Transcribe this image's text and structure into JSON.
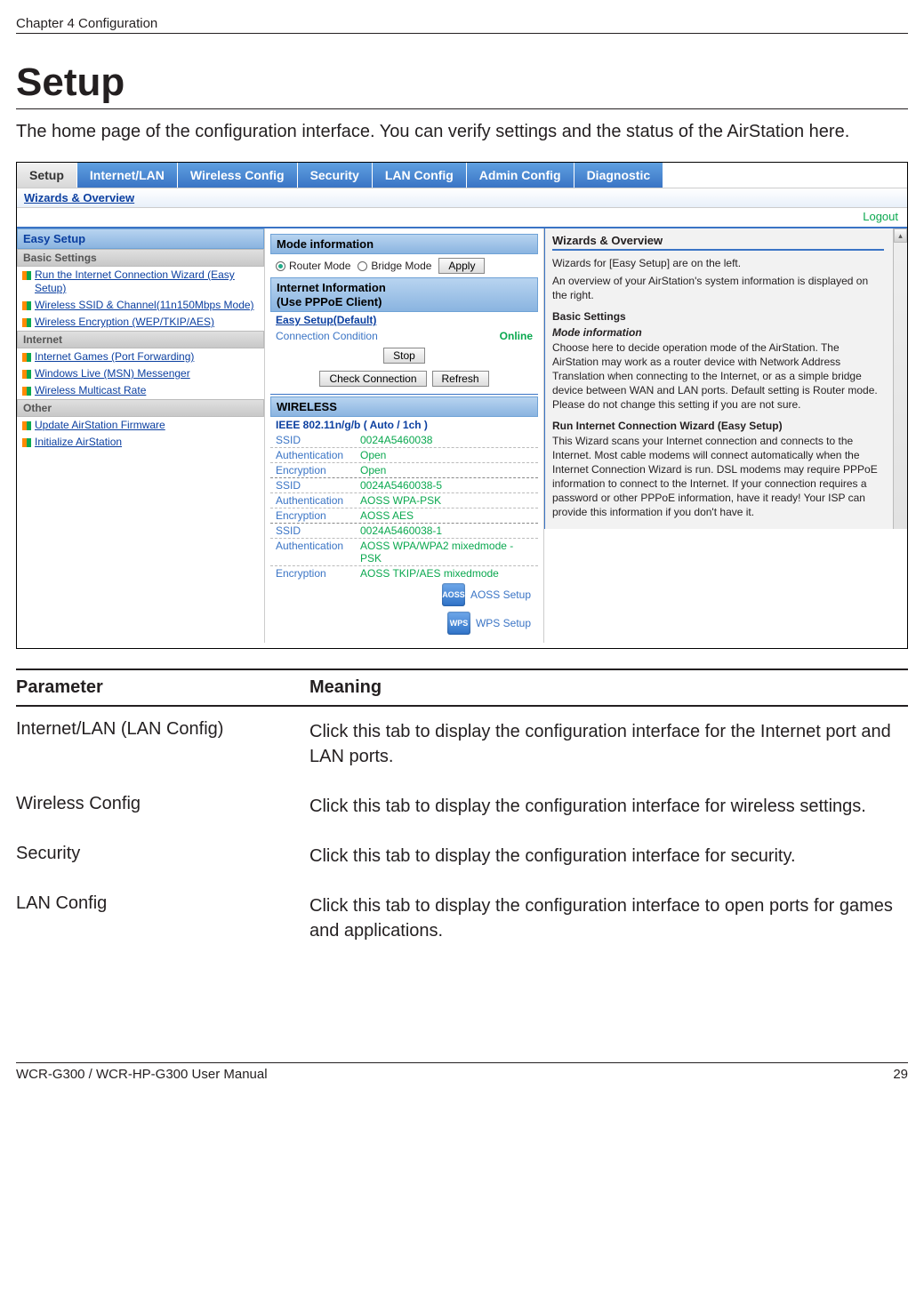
{
  "doc": {
    "header_left": "Chapter 4  Configuration",
    "title": "Setup",
    "intro": "The home page of the configuration interface. You can verify settings and the status of the AirStation here.",
    "footer_left": "WCR-G300 / WCR-HP-G300 User Manual",
    "footer_right": "29"
  },
  "tabs": {
    "setup": "Setup",
    "internet_lan": "Internet/LAN",
    "wireless": "Wireless Config",
    "security": "Security",
    "lan": "LAN Config",
    "admin": "Admin Config",
    "diag": "Diagnostic"
  },
  "subnav": {
    "link": "Wizards & Overview"
  },
  "logout": "Logout",
  "left": {
    "head": "Easy Setup",
    "sub_basic": "Basic Settings",
    "links_basic": [
      "Run the Internet Connection Wizard (Easy Setup)",
      "Wireless SSID & Channel(11n150Mbps Mode)",
      "Wireless Encryption (WEP/TKIP/AES)"
    ],
    "sub_internet": "Internet",
    "links_internet": [
      "Internet Games (Port Forwarding)",
      "Windows Live (MSN) Messenger",
      "Wireless Multicast Rate"
    ],
    "sub_other": "Other",
    "links_other": [
      "Update AirStation Firmware",
      "Initialize AirStation"
    ]
  },
  "mid": {
    "mode_head": "Mode information",
    "mode_router": "Router Mode",
    "mode_bridge": "Bridge Mode",
    "apply": "Apply",
    "inet_head1": "Internet Information",
    "inet_head2": "(Use PPPoE Client)",
    "easy_default": "Easy Setup(Default)",
    "conn_cond_label": "Connection Condition",
    "conn_cond_value": "Online",
    "stop": "Stop",
    "check_conn": "Check Connection",
    "refresh": "Refresh",
    "wireless_head": "WIRELESS",
    "ieee": "IEEE 802.11n/g/b ( Auto / 1ch )",
    "rows": [
      {
        "k": "SSID",
        "v": "0024A5460038"
      },
      {
        "k": "Authentication",
        "v": "Open"
      },
      {
        "k": "Encryption",
        "v": "Open"
      },
      {
        "k": "SSID",
        "v": "0024A5460038-5"
      },
      {
        "k": "Authentication",
        "v": "AOSS WPA-PSK"
      },
      {
        "k": "Encryption",
        "v": "AOSS AES"
      },
      {
        "k": "SSID",
        "v": "0024A5460038-1"
      },
      {
        "k": "Authentication",
        "v": "AOSS WPA/WPA2 mixedmode - PSK"
      },
      {
        "k": "Encryption",
        "v": "AOSS TKIP/AES mixedmode"
      }
    ],
    "aoss_setup": "AOSS Setup",
    "wps_setup": "WPS Setup"
  },
  "right": {
    "title": "Wizards & Overview",
    "p1": "Wizards for [Easy Setup] are on the left.",
    "p2": "An overview of your AirStation's system information is displayed on the right.",
    "h_basic": "Basic Settings",
    "h_mode": "Mode information",
    "p_mode": "Choose here to decide operation mode of the AirStation. The AirStation may work as a router device with Network Address Translation when connecting to the Internet, or as a simple bridge device between WAN and LAN ports. Default setting is Router mode. Please do not change this setting if you are not sure.",
    "h_wizard": "Run Internet Connection Wizard (Easy Setup)",
    "p_wizard": "This Wizard scans your Internet connection and connects to the Internet. Most cable modems will connect automatically when the Internet Connection Wizard is run. DSL modems may require PPPoE information to connect to the Internet. If your connection requires a password or other PPPoE information, have it ready! Your ISP can provide this information if you don't have it."
  },
  "params": {
    "head_param": "Parameter",
    "head_meaning": "Meaning",
    "rows": [
      {
        "p": "Internet/LAN (LAN Config)",
        "m": "Click this tab to display the configuration interface for the Internet port and LAN ports."
      },
      {
        "p": "Wireless Config",
        "m": "Click this tab to display the configuration interface for wireless settings."
      },
      {
        "p": "Security",
        "m": "Click this tab to display the configuration interface for security."
      },
      {
        "p": "LAN Config",
        "m": "Click this tab to display the configuration interface to open ports for games and applications."
      }
    ]
  }
}
